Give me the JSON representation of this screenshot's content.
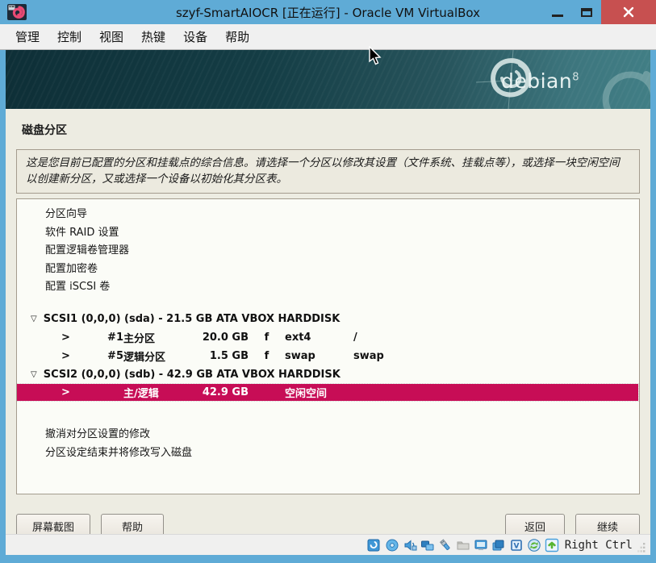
{
  "window": {
    "title": "szyf-SmartAIOCR [正在运行] - Oracle VM VirtualBox"
  },
  "menu_bar": {
    "items": [
      "管理",
      "控制",
      "视图",
      "热键",
      "设备",
      "帮助"
    ]
  },
  "banner": {
    "brand": "debian",
    "version": "8"
  },
  "installer": {
    "page_title": "磁盘分区",
    "description": "这是您目前已配置的分区和挂载点的综合信息。请选择一个分区以修改其设置（文件系统、挂载点等），或选择一块空闲空间以创建新分区，又或选择一个设备以初始化其分区表。",
    "menu_items": [
      "分区向导",
      "软件 RAID 设置",
      "配置逻辑卷管理器",
      "配置加密卷",
      "配置 iSCSI 卷"
    ],
    "disks": [
      {
        "twisty": "▽",
        "label": "SCSI1 (0,0,0) (sda) - 21.5 GB ATA VBOX HARDDISK",
        "partitions": [
          {
            "arrow": ">",
            "num": "#1",
            "type": "主分区",
            "size": "20.0 GB",
            "flag": "f",
            "fs": "ext4",
            "mount": "/"
          },
          {
            "arrow": ">",
            "num": "#5",
            "type": "逻辑分区",
            "size": "1.5 GB",
            "flag": "f",
            "fs": "swap",
            "mount": "swap"
          }
        ]
      },
      {
        "twisty": "▽",
        "label": "SCSI2 (0,0,0) (sdb) - 42.9 GB ATA VBOX HARDDISK",
        "partitions": [
          {
            "arrow": ">",
            "num": "",
            "type": "主/逻辑",
            "size": "42.9 GB",
            "flag": "",
            "fs": "空闲空间",
            "mount": ""
          }
        ]
      }
    ],
    "actions": [
      "撤消对分区设置的修改",
      "分区设定结束并将修改写入磁盘"
    ],
    "footer_buttons": {
      "screenshot": "屏幕截图",
      "help": "帮助",
      "back": "返回",
      "continue": "继续"
    }
  },
  "status_bar": {
    "host_key": "Right Ctrl",
    "icons": [
      "hard-disk",
      "optical-disc",
      "audio",
      "network",
      "usb",
      "shared-folders",
      "display",
      "video-capture",
      "features-chip",
      "mouse-integration",
      "keyboard-capture"
    ]
  },
  "colors": {
    "titlebar": "#5fabd6",
    "close_button": "#c75050",
    "banner_dark": "#0e2f37",
    "banner_light": "#417e85",
    "selection": "#c70d56",
    "page_bg": "#edece2",
    "list_bg": "#fbfcf7"
  }
}
